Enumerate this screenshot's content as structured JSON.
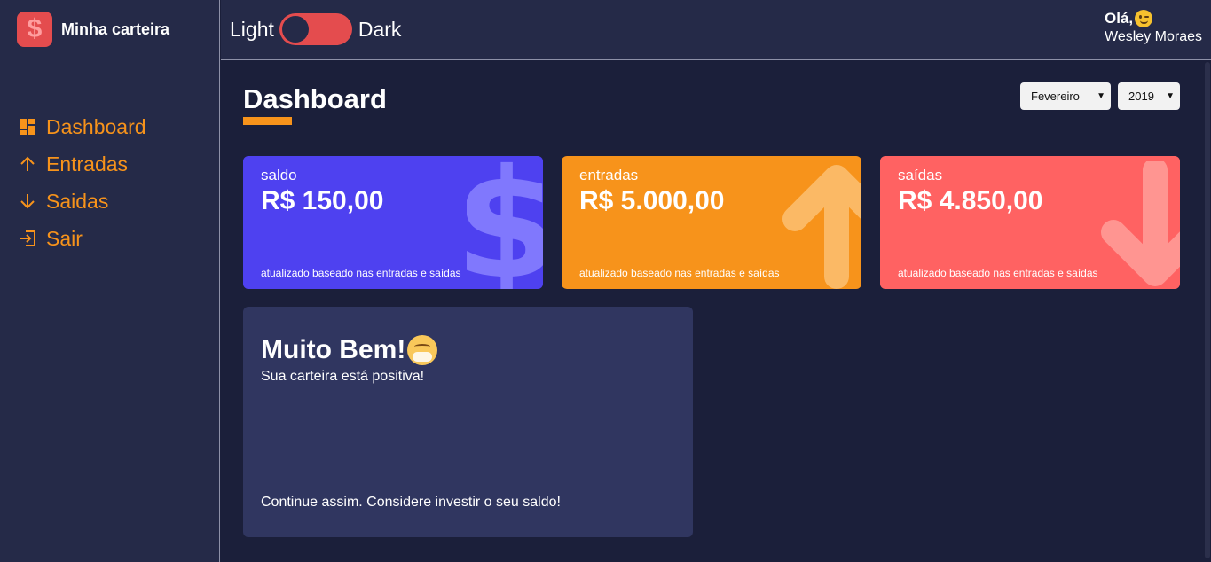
{
  "brand": {
    "title": "Minha carteira",
    "logo_symbol": "$"
  },
  "sidebar": {
    "items": [
      {
        "label": "Dashboard",
        "icon": "dashboard-icon"
      },
      {
        "label": "Entradas",
        "icon": "arrow-up-icon"
      },
      {
        "label": "Saidas",
        "icon": "arrow-down-icon"
      },
      {
        "label": "Sair",
        "icon": "logout-icon"
      }
    ]
  },
  "header": {
    "toggle": {
      "left_label": "Light",
      "right_label": "Dark"
    },
    "greeting": "Olá,",
    "username": "Wesley Moraes"
  },
  "main": {
    "title": "Dashboard",
    "filters": {
      "month": "Fevereiro",
      "year": "2019"
    },
    "cards": [
      {
        "label": "saldo",
        "amount": "R$ 150,00",
        "footer": "atualizado baseado nas entradas e saídas",
        "icon": "dollar-icon",
        "color": "#4e41f0"
      },
      {
        "label": "entradas",
        "amount": "R$ 5.000,00",
        "footer": "atualizado baseado nas entradas e saídas",
        "icon": "arrow-up-icon",
        "color": "#f7931b"
      },
      {
        "label": "saídas",
        "amount": "R$ 4.850,00",
        "footer": "atualizado baseado nas entradas e saídas",
        "icon": "arrow-down-icon",
        "color": "#ff6262"
      }
    ],
    "message": {
      "title": "Muito Bem!",
      "description": "Sua carteira está positiva!",
      "footer": "Continue assim. Considere investir o seu saldo!"
    }
  },
  "colors": {
    "accent": "#f7931b",
    "danger": "#e44c4e",
    "sidebar_bg": "#252a48",
    "page_bg": "#1b1f3a"
  }
}
